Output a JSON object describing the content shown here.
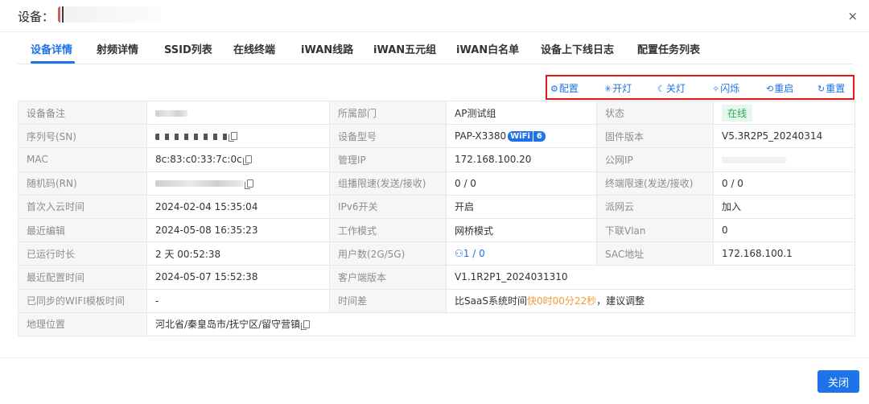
{
  "dialog": {
    "title": "设备：",
    "close_icon": "×"
  },
  "tabs": [
    {
      "label": "设备详情",
      "active": true
    },
    {
      "label": "射频详情"
    },
    {
      "label": "SSID列表"
    },
    {
      "label": "在线终端"
    },
    {
      "label": "iWAN线路"
    },
    {
      "label": "iWAN五元组"
    },
    {
      "label": "iWAN白名单"
    },
    {
      "label": "设备上下线日志"
    },
    {
      "label": "配置任务列表"
    }
  ],
  "actions": [
    {
      "icon": "⚙",
      "label": "配置"
    },
    {
      "icon": "✳",
      "label": "开灯"
    },
    {
      "icon": "☾",
      "label": "关灯"
    },
    {
      "icon": "✧",
      "label": "闪烁"
    },
    {
      "icon": "⟲",
      "label": "重启"
    },
    {
      "icon": "↻",
      "label": "重置"
    }
  ],
  "info": {
    "remark_label": "设备备注",
    "dept_label": "所属部门",
    "dept_value": "AP测试组",
    "status_label": "状态",
    "status_value": "在线",
    "sn_label": "序列号(SN)",
    "model_label": "设备型号",
    "model_value": "PAP-X3380",
    "wifi_word": "WiFi",
    "wifi_num": "6",
    "fw_label": "固件版本",
    "fw_value": "V5.3R2P5_20240314",
    "mac_label": "MAC",
    "mac_value": "8c:83:c0:33:7c:0c",
    "mgmt_ip_label": "管理IP",
    "mgmt_ip_value": "172.168.100.20",
    "public_ip_label": "公网IP",
    "rn_label": "随机码(RN)",
    "mcast_label": "组播限速(发送/接收)",
    "mcast_value": "0 / 0",
    "term_label": "终端限速(发送/接收)",
    "term_value": "0 / 0",
    "first_cloud_label": "首次入云时间",
    "first_cloud_value": "2024-02-04 15:35:04",
    "ipv6_label": "IPv6开关",
    "ipv6_value": "开启",
    "paiwang_label": "派网云",
    "paiwang_value": "加入",
    "last_edit_label": "最近编辑",
    "last_edit_value": "2024-05-08 16:35:23",
    "mode_label": "工作模式",
    "mode_value": "网桥模式",
    "vlan_label": "下联Vlan",
    "vlan_value": "0",
    "uptime_label": "已运行时长",
    "uptime_value": "2 天 00:52:38",
    "users_label": "用户数(2G/5G)",
    "users_value": "1 / 0",
    "sac_label": "SAC地址",
    "sac_value": "172.168.100.1",
    "last_config_label": "最近配置时间",
    "last_config_value": "2024-05-07 15:52:38",
    "client_ver_label": "客户端版本",
    "client_ver_value": "V1.1R2P1_2024031310",
    "wifi_tpl_label": "已同步的WIFI模板时间",
    "wifi_tpl_value": "-",
    "timediff_label": "时间差",
    "timediff_prefix": "比SaaS系统时间",
    "timediff_warn": "快0时00分22秒",
    "timediff_suffix": "，建议调整",
    "location_label": "地理位置",
    "location_value": "河北省/秦皇岛市/抚宁区/留守营镇"
  },
  "footer": {
    "close_label": "关闭"
  },
  "colors": {
    "accent": "#1e73e8",
    "online": "#27a85b",
    "warning": "#f39a3c",
    "highlight_box": "#e8151b"
  }
}
